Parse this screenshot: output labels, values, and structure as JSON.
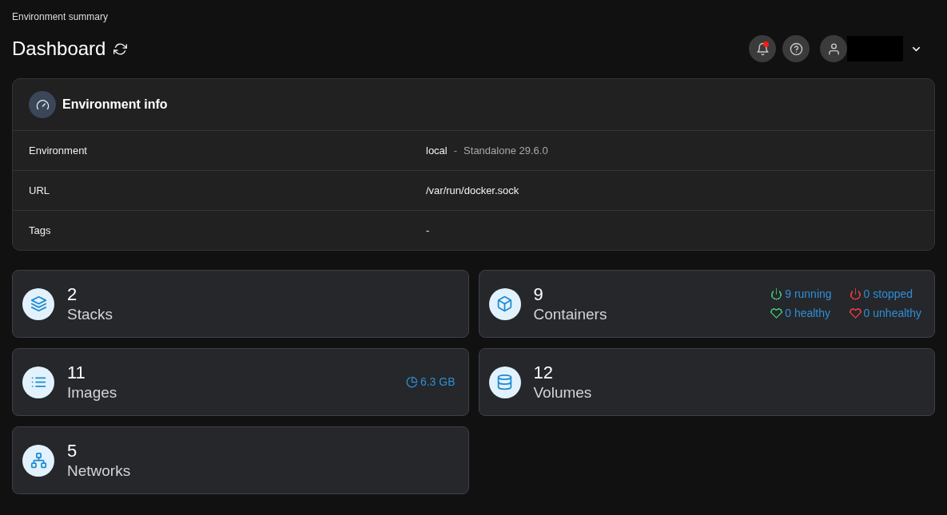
{
  "breadcrumb": "Environment summary",
  "page_title": "Dashboard",
  "notifications": {
    "unread": true
  },
  "user": {
    "name_redacted": true
  },
  "environment_info": {
    "title": "Environment info",
    "rows": [
      {
        "label": "Environment",
        "value": "local",
        "separator": "-",
        "detail": "Standalone 29.6.0"
      },
      {
        "label": "URL",
        "value": "/var/run/docker.sock"
      },
      {
        "label": "Tags",
        "value": "-"
      }
    ]
  },
  "tiles": [
    {
      "kind": "stacks",
      "count": "2",
      "label": "Stacks"
    },
    {
      "kind": "containers",
      "count": "9",
      "label": "Containers",
      "stats": [
        {
          "kind": "power",
          "color": "#3fb26b",
          "text": "9 running"
        },
        {
          "kind": "power",
          "color": "#d63a3a",
          "text": "0 stopped"
        },
        {
          "kind": "heart",
          "color": "#3fb26b",
          "text": "0 healthy"
        },
        {
          "kind": "heart",
          "color": "#d63a3a",
          "text": "0 unhealthy"
        }
      ]
    },
    {
      "kind": "images",
      "count": "11",
      "label": "Images",
      "size": "6.3 GB"
    },
    {
      "kind": "volumes",
      "count": "12",
      "label": "Volumes"
    },
    {
      "kind": "networks",
      "count": "5",
      "label": "Networks"
    }
  ]
}
